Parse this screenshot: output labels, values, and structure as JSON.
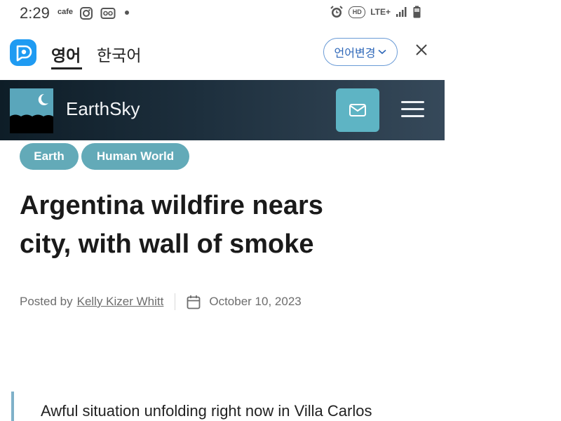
{
  "status_bar": {
    "time": "2:29",
    "cafe_label": "cafe",
    "network_label": "LTE+",
    "hd_label": "HD",
    "icons": [
      "instagram-icon",
      "vr-icon",
      "alarm-icon",
      "hd-voice-icon",
      "signal-icon",
      "battery-icon"
    ]
  },
  "translator": {
    "tab_source": "영어",
    "tab_target": "한국어",
    "change_language_label": "언어변경",
    "accent_color": "#1f9bf2"
  },
  "site": {
    "name": "EarthSky",
    "header_colors": [
      "#0e1d27",
      "#36495a"
    ],
    "button_color": "#5eb4c4"
  },
  "article": {
    "tags": [
      "Earth",
      "Human World"
    ],
    "headline_line1": "Argentina wildfire nears",
    "headline_line2": "city, with wall of smoke",
    "posted_by_label": "Posted by",
    "author": "Kelly Kizer Whitt",
    "date": "October 10, 2023",
    "quote_text": "Awful situation unfolding right now in Villa Carlos"
  }
}
